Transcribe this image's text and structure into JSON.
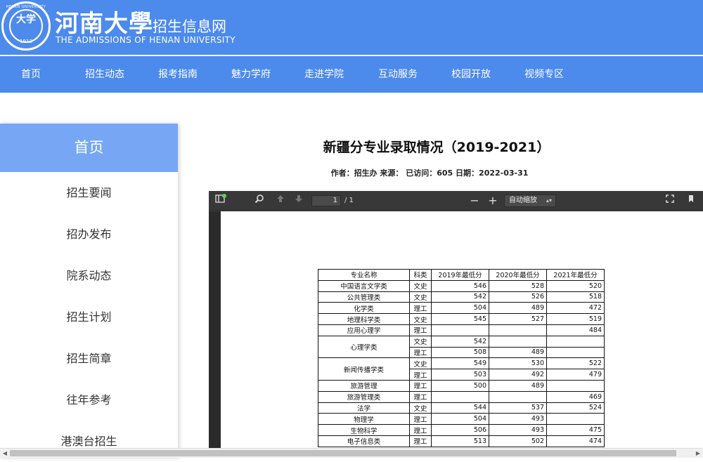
{
  "header": {
    "site_name": "河南大學",
    "site_sub": "招生信息网",
    "site_en": "THE ADMISSIONS OF HENAN UNIVERSITY",
    "seal_ring": "HENAN UNIVERSITY",
    "seal_glyph": "大学",
    "seal_year": "1912",
    "brand_color": "#4c8aec"
  },
  "nav": {
    "items": [
      "首页",
      "招生动态",
      "报考指南",
      "魅力学府",
      "走进学院",
      "互动服务",
      "校园开放",
      "视频专区"
    ]
  },
  "sidebar": {
    "home": "首页",
    "items": [
      "招生要闻",
      "招办发布",
      "院系动态",
      "招生计划",
      "招生简章",
      "往年参考",
      "港澳台招生"
    ]
  },
  "article": {
    "title": "新疆分专业录取情况（2019-2021）",
    "meta": "作者：招生办   来源：    已访问：605  日期：2022-03-31"
  },
  "pdf_viewer": {
    "page_current": "1",
    "page_total": "/ 1",
    "zoom": "自动缩放",
    "icons": [
      "sidebar-toggle-icon",
      "search-icon",
      "arrow-up-icon",
      "arrow-down-icon",
      "zoom-out-icon",
      "zoom-in-icon",
      "fullscreen-icon",
      "bookmark-icon"
    ]
  },
  "table": {
    "headers": [
      "专业名称",
      "科类",
      "2019年最低分",
      "2020年最低分",
      "2021年最低分"
    ],
    "rows": [
      [
        "中国语言文学类",
        "文史",
        "546",
        "528",
        "520"
      ],
      [
        "公共管理类",
        "文史",
        "542",
        "526",
        "518"
      ],
      [
        "化学类",
        "理工",
        "504",
        "489",
        "472"
      ],
      [
        "地理科学类",
        "文史",
        "545",
        "527",
        "519"
      ],
      [
        "应用心理学",
        "理工",
        "",
        "",
        "484"
      ],
      [
        "心理学类",
        "文史",
        "542",
        "",
        ""
      ],
      [
        "",
        "理工",
        "508",
        "489",
        ""
      ],
      [
        "新闻传播学类",
        "文史",
        "549",
        "530",
        "522"
      ],
      [
        "",
        "理工",
        "503",
        "492",
        "479"
      ],
      [
        "旅游管理",
        "理工",
        "500",
        "489",
        ""
      ],
      [
        "旅游管理类",
        "理工",
        "",
        "",
        "469"
      ],
      [
        "法学",
        "文史",
        "544",
        "537",
        "524"
      ],
      [
        "物理学",
        "理工",
        "504",
        "493",
        ""
      ],
      [
        "生物科学",
        "理工",
        "506",
        "493",
        "475"
      ],
      [
        "电子信息类",
        "理工",
        "513",
        "502",
        "474"
      ]
    ]
  }
}
